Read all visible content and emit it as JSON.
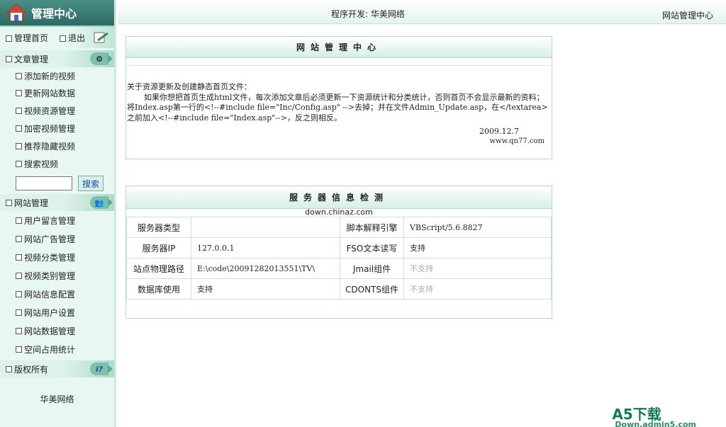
{
  "sidebar": {
    "logo_title": "管理中心",
    "top_links": [
      "管理首页",
      "退出"
    ],
    "sections": {
      "articles": {
        "title": "文章管理",
        "items": [
          "添加新的视频",
          "更新网站数据",
          "视频资源管理",
          "加密视频管理",
          "推荐隐藏视频",
          "搜索视频"
        ]
      },
      "search": {
        "value": "",
        "button": "搜索"
      },
      "site": {
        "title": "网站管理",
        "items": [
          "用户留言管理",
          "网站广告管理",
          "视频分类管理",
          "视频类别管理",
          "网站信息配置",
          "网站用户设置",
          "网站数据管理",
          "空间占用统计"
        ]
      },
      "copyright": {
        "title": "版权所有"
      }
    },
    "footer": "华美网络"
  },
  "topbar": {
    "developer": "程序开发: 华美网络",
    "right_title": "网站管理中心"
  },
  "panel1": {
    "title": "网站管理中心",
    "line1": "关于资源更新及创建静态首页文件：",
    "para": "如果你想把首页生成html文件，每次添加文章后必须更新一下资源统计和分类统计，否则首页不会显示最新的资料；将Index.asp第一行的<!--#include file=\"Inc/Config.asp\" -->去掉；并在文件Admin_Update.asp，在</textarea>之前加入<!--#include file=\"Index.asp\"-->，反之则相反。",
    "date": "2009.12.7",
    "site": "www.qn77.com"
  },
  "panel2": {
    "title": "服务器信息检测",
    "watermark": "down.chinaz.com",
    "rows": [
      {
        "l1": "服务器类型",
        "v1": "",
        "l2": "脚本解释引擎",
        "v2": "VBScript/5.6.8827"
      },
      {
        "l1": "服务器IP",
        "v1": "127.0.0.1",
        "l2": "FSO文本读写",
        "v2": "支持"
      },
      {
        "l1": "站点物理路径",
        "v1": "E:\\code\\20091282013551\\TV\\",
        "l2": "Jmail组件",
        "v2": "不支持"
      },
      {
        "l1": "数据库使用",
        "v1": "支持",
        "l2": "CDONTS组件",
        "v2": "不支持"
      }
    ]
  },
  "watermark_a5": {
    "brand": "A5下载",
    "domain": "Down.admin5.com"
  },
  "colors": {
    "accent": "#2d6a63",
    "panel_border": "#b8d8cf",
    "sidebar_bg": "#e9f7f2"
  }
}
